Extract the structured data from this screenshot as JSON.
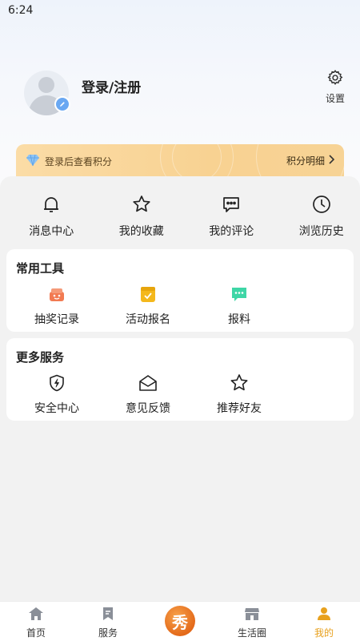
{
  "status_bar": {
    "time": "6:24"
  },
  "profile": {
    "login_label": "登录/注册",
    "settings_label": "设置"
  },
  "points_banner": {
    "text": "登录后查看积分",
    "detail_label": "积分明细"
  },
  "quick_actions": [
    {
      "icon": "bell-icon",
      "label": "消息中心"
    },
    {
      "icon": "star-icon",
      "label": "我的收藏"
    },
    {
      "icon": "comment-icon",
      "label": "我的评论"
    },
    {
      "icon": "clock-icon",
      "label": "浏览历史"
    }
  ],
  "tools": {
    "title": "常用工具",
    "items": [
      {
        "icon": "lottery-icon",
        "label": "抽奖记录",
        "color": "#f27a52"
      },
      {
        "icon": "calendar-check-icon",
        "label": "活动报名",
        "color": "#f4b81c"
      },
      {
        "icon": "report-chat-icon",
        "label": "报料",
        "color": "#3ed6a6"
      }
    ]
  },
  "services": {
    "title": "更多服务",
    "items": [
      {
        "icon": "shield-bolt-icon",
        "label": "安全中心"
      },
      {
        "icon": "envelope-open-icon",
        "label": "意见反馈"
      },
      {
        "icon": "star-outline-icon",
        "label": "推荐好友"
      }
    ]
  },
  "tab_bar": {
    "tabs": [
      {
        "icon": "home-icon",
        "label": "首页"
      },
      {
        "icon": "bookmark-icon",
        "label": "服务"
      },
      {
        "icon": "center-logo-icon",
        "label": ""
      },
      {
        "icon": "store-icon",
        "label": "生活圈"
      },
      {
        "icon": "person-icon",
        "label": "我的"
      }
    ],
    "active_color": "#e8a11e",
    "logo_glyph": "秀"
  }
}
